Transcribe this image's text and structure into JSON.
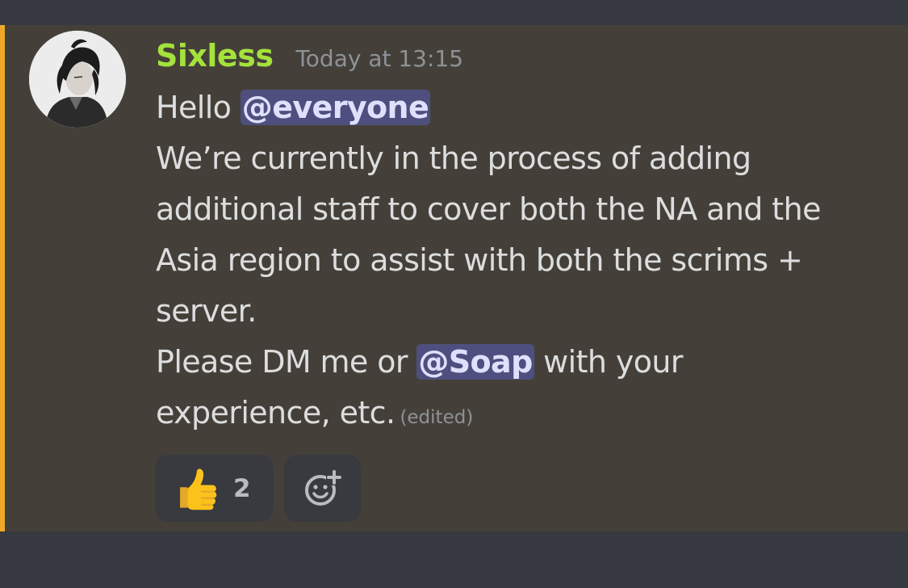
{
  "message": {
    "author": "Sixless",
    "timestamp": "Today at 13:15",
    "line1_text": "Hello ",
    "mention_everyone": "@everyone",
    "line2": "We’re currently in the process of adding",
    "line3": "additional staff to cover both the NA and the",
    "line4": "Asia region to assist with both the scrims +",
    "line5": "server.",
    "line6_text": "Please DM me or ",
    "mention_soap": "@Soap",
    "line6_rest": " with your",
    "line7": "experience, etc.",
    "edited_label": "(edited)"
  },
  "reactions": [
    {
      "emoji": "thumbs-up-icon",
      "count": "2"
    }
  ],
  "add_reaction_icon": "add-reaction-icon",
  "colors": {
    "username": "#a4e23c",
    "mention_bar": "#f0a82a",
    "mention_bg": "#4e4f7e",
    "mention_text": "#dee0fc",
    "message_bg": "#444039",
    "app_bg": "#36393f"
  }
}
